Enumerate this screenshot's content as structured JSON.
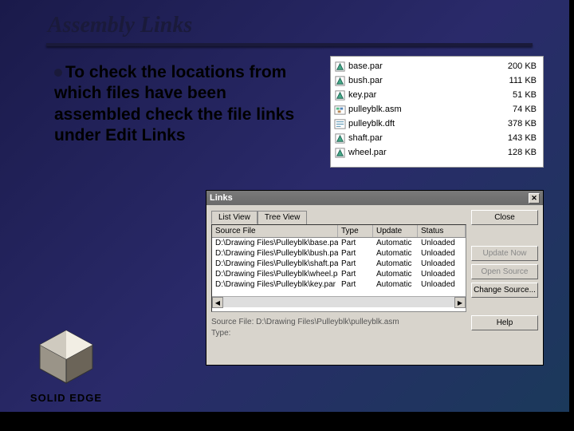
{
  "slide": {
    "title": "Assembly Links",
    "bullet": "To check the locations from which files have been assembled check the file links under Edit Links"
  },
  "file_list": [
    {
      "iconType": "par",
      "name": "base.par",
      "size": "200 KB"
    },
    {
      "iconType": "par",
      "name": "bush.par",
      "size": "111 KB"
    },
    {
      "iconType": "par",
      "name": "key.par",
      "size": "51 KB"
    },
    {
      "iconType": "asm",
      "name": "pulleyblk.asm",
      "size": "74 KB"
    },
    {
      "iconType": "dft",
      "name": "pulleyblk.dft",
      "size": "378 KB"
    },
    {
      "iconType": "par",
      "name": "shaft.par",
      "size": "143 KB"
    },
    {
      "iconType": "par",
      "name": "wheel.par",
      "size": "128 KB"
    }
  ],
  "links_dialog": {
    "title": "Links",
    "tabs": {
      "list": "List View",
      "tree": "Tree View"
    },
    "headers": {
      "source": "Source File",
      "type": "Type",
      "update": "Update",
      "status": "Status"
    },
    "rows": [
      {
        "source": "D:\\Drawing Files\\Pulleyblk\\base.par",
        "type": "Part",
        "update": "Automatic",
        "status": "Unloaded"
      },
      {
        "source": "D:\\Drawing Files\\Pulleyblk\\bush.par",
        "type": "Part",
        "update": "Automatic",
        "status": "Unloaded"
      },
      {
        "source": "D:\\Drawing Files\\Pulleyblk\\shaft.par",
        "type": "Part",
        "update": "Automatic",
        "status": "Unloaded"
      },
      {
        "source": "D:\\Drawing Files\\Pulleyblk\\wheel.par",
        "type": "Part",
        "update": "Automatic",
        "status": "Unloaded"
      },
      {
        "source": "D:\\Drawing Files\\Pulleyblk\\key.par",
        "type": "Part",
        "update": "Automatic",
        "status": "Unloaded"
      }
    ],
    "source_info": {
      "label": "Source File:",
      "value": "D:\\Drawing Files\\Pulleyblk\\pulleyblk.asm",
      "type_label": "Type:"
    },
    "buttons": {
      "close": "Close",
      "update_now": "Update Now",
      "open_source": "Open Source",
      "change_source": "Change Source...",
      "help": "Help"
    }
  },
  "logo": {
    "text": "SOLID EDGE"
  }
}
